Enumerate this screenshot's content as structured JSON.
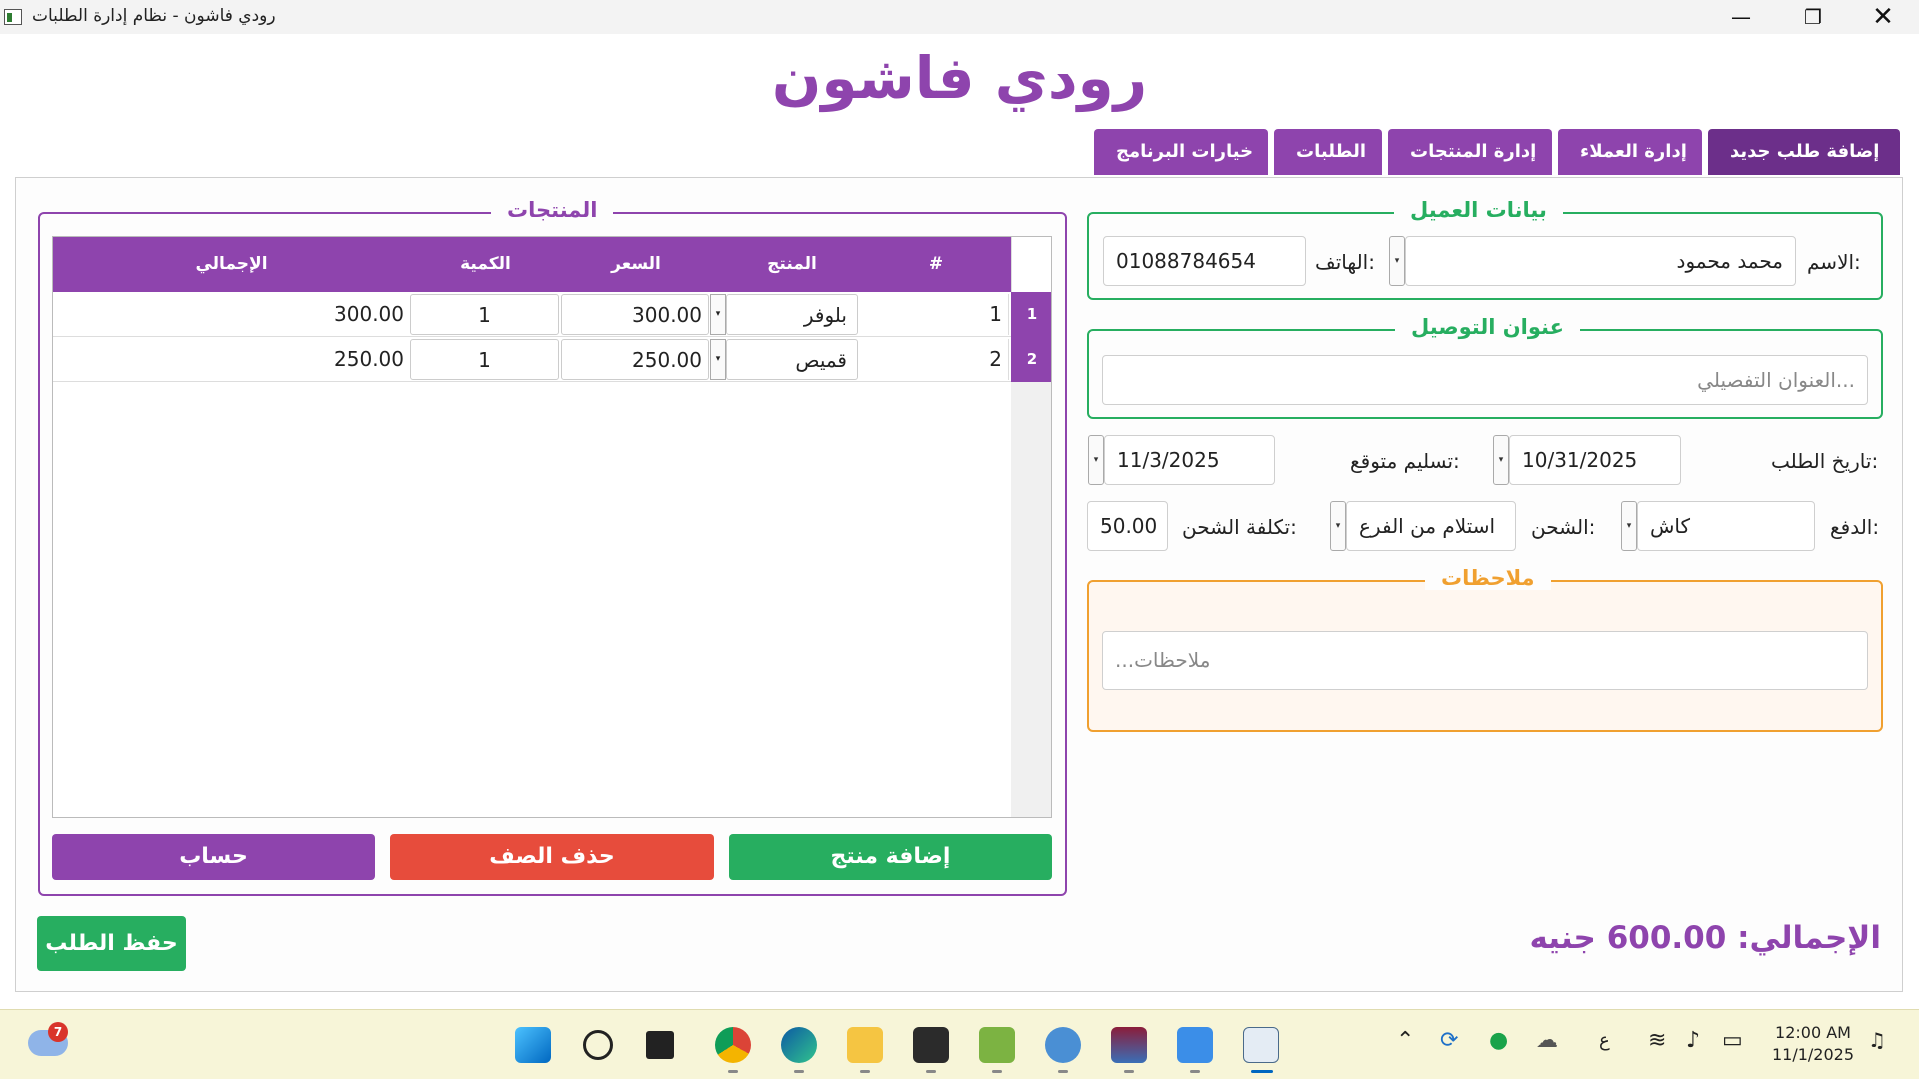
{
  "window": {
    "title": "رودي فاشون - نظام إدارة الطلبات",
    "minimize": "—",
    "maximize": "❐",
    "close": "✕"
  },
  "header": {
    "brand": "رودي فاشون"
  },
  "tabs": [
    {
      "label": "إضافة طلب جديد",
      "active": true
    },
    {
      "label": "إدارة العملاء",
      "active": false
    },
    {
      "label": "إدارة المنتجات",
      "active": false
    },
    {
      "label": "الطلبات",
      "active": false
    },
    {
      "label": "خيارات البرنامج",
      "active": false
    }
  ],
  "customer": {
    "title": "بيانات العميل",
    "name_label": "الاسم:",
    "name_value": "محمد محمود",
    "phone_label": "الهاتف:",
    "phone_value": "01088784654"
  },
  "address": {
    "title": "عنوان التوصيل",
    "placeholder": "العنوان التفصيلي..."
  },
  "order": {
    "date_label": "تاريخ الطلب:",
    "date_value": "10/31/2025",
    "delivery_label": "تسليم متوقع:",
    "delivery_value": "11/3/2025",
    "payment_label": "الدفع:",
    "payment_value": "كاش",
    "shipping_label": "الشحن:",
    "shipping_value": "استلام من الفرع",
    "shipping_cost_label": "تكلفة الشحن:",
    "shipping_cost_value": "50.00"
  },
  "notes": {
    "title": "ملاحظات",
    "placeholder": "...ملاحظات"
  },
  "products": {
    "title": "المنتجات",
    "columns": {
      "num": "#",
      "product": "المنتج",
      "price": "السعر",
      "qty": "الكمية",
      "total": "الإجمالي"
    },
    "rows": [
      {
        "row_header": "1",
        "num": "1",
        "product": "بلوفر",
        "price": "300.00",
        "qty": "1",
        "total": "300.00"
      },
      {
        "row_header": "2",
        "num": "2",
        "product": "قميص",
        "price": "250.00",
        "qty": "1",
        "total": "250.00"
      }
    ],
    "add_button": "إضافة منتج",
    "delete_button": "حذف الصف",
    "calc_button": "حساب"
  },
  "footer": {
    "save_button": "حفظ الطلب",
    "total_text": "الإجمالي: 600.00 جنيه"
  },
  "taskbar": {
    "weather_badge": "7",
    "lang": "ع",
    "time": "12:00 AM",
    "date": "11/1/2025"
  }
}
